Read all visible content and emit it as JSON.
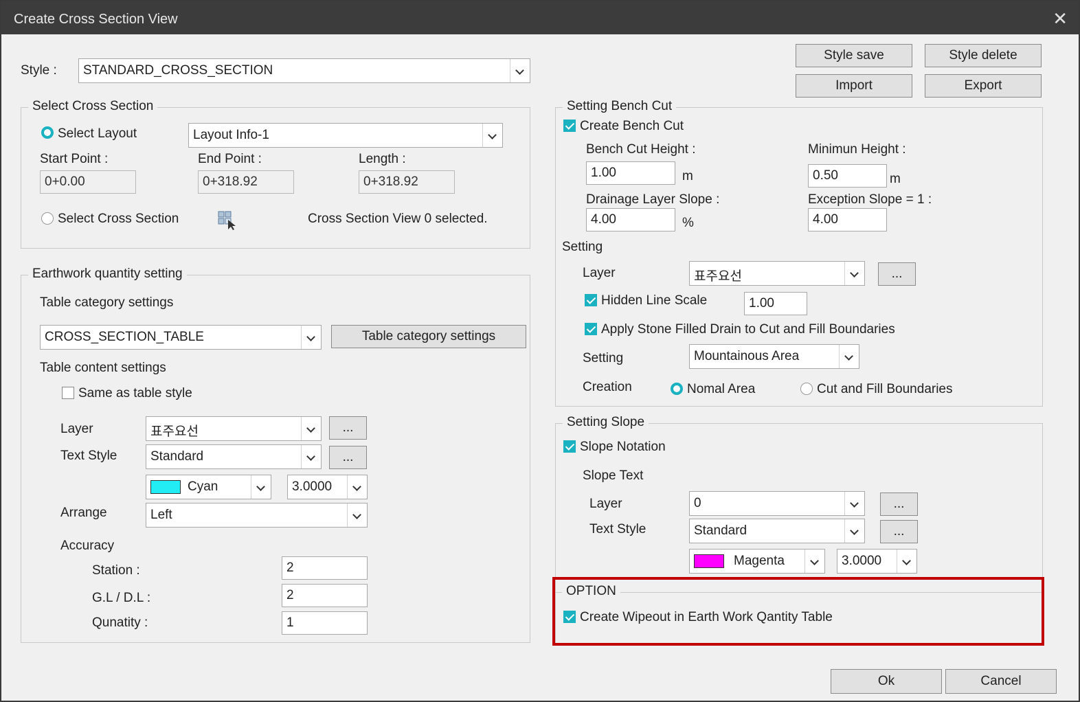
{
  "window": {
    "title": "Create Cross Section View"
  },
  "style": {
    "label": "Style :",
    "value": "STANDARD_CROSS_SECTION"
  },
  "buttons": {
    "style_save": "Style save",
    "style_delete": "Style delete",
    "import": "Import",
    "export": "Export",
    "ok": "Ok",
    "cancel": "Cancel"
  },
  "select_cross_section": {
    "title": "Select Cross Section",
    "select_layout": "Select Layout",
    "layout_value": "Layout Info-1",
    "start_label": "Start Point :",
    "start_value": "0+0.00",
    "end_label": "End Point :",
    "end_value": "0+318.92",
    "length_label": "Length :",
    "length_value": "0+318.92",
    "select_cross_section": "Select Cross Section",
    "status": "Cross Section View 0 selected."
  },
  "earthwork": {
    "title": "Earthwork quantity setting",
    "table_category_label": "Table category settings",
    "table_value": "CROSS_SECTION_TABLE",
    "table_category_button": "Table category settings",
    "table_content_label": "Table content settings",
    "same_as_style": "Same as table style",
    "layer_label": "Layer",
    "layer_value": "표주요선",
    "layer_more": "...",
    "text_style_label": "Text Style",
    "text_style_value": "Standard",
    "text_style_more": "...",
    "color_value": "Cyan",
    "color_hex": "#22ecf4",
    "size_value": "3.0000",
    "arrange_label": "Arrange",
    "arrange_value": "Left",
    "accuracy_label": "Accuracy",
    "station_label": "Station :",
    "station_value": "2",
    "gl_label": "G.L / D.L :",
    "gl_value": "2",
    "quantity_label": "Qunatity :",
    "quantity_value": "1"
  },
  "bench_cut": {
    "title": "Setting Bench Cut",
    "create": "Create Bench Cut",
    "height_label": "Bench Cut Height :",
    "height_value": "1.00",
    "height_unit": "m",
    "min_label": "Minimun Height :",
    "min_value": "0.50",
    "min_unit": "m",
    "drain_label": "Drainage Layer Slope :",
    "drain_value": "4.00",
    "drain_unit": "%",
    "exception_label": "Exception Slope = 1 :",
    "exception_value": "4.00",
    "setting_label": "Setting",
    "layer_label": "Layer",
    "layer_value": "표주요선",
    "layer_more": "...",
    "hidden_label": "Hidden Line Scale",
    "hidden_value": "1.00",
    "stone_label": "Apply Stone Filled Drain to Cut and Fill Boundaries",
    "setting2_label": "Setting",
    "setting2_value": "Mountainous Area",
    "creation_label": "Creation",
    "normal": "Nomal Area",
    "cut_fill": "Cut and Fill Boundaries"
  },
  "slope": {
    "title": "Setting Slope",
    "notation": "Slope Notation",
    "slope_text": "Slope Text",
    "layer_label": "Layer",
    "layer_value": "0",
    "layer_more": "...",
    "text_style_label": "Text Style",
    "text_style_value": "Standard",
    "text_style_more": "...",
    "color_value": "Magenta",
    "color_hex": "#ff00ff",
    "size_value": "3.0000"
  },
  "option": {
    "title": "OPTION",
    "wipeout": "Create Wipeout in Earth Work Qantity Table"
  }
}
